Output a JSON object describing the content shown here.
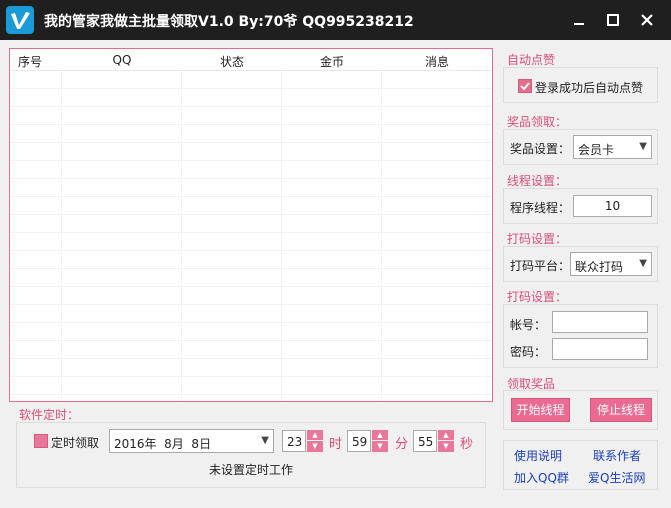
{
  "window": {
    "title": "我的管家我做主批量领取V1.0 By:70爷 QQ995238212"
  },
  "list": {
    "columns": [
      "序号",
      "QQ",
      "状态",
      "金币",
      "消息"
    ]
  },
  "auto_like": {
    "group_label": "自动点赞",
    "checkbox_label": "登录成功后自动点赞",
    "checked": true
  },
  "prize": {
    "group_label": "奖品领取：",
    "setting_label": "奖品设置：",
    "setting_value": "会员卡"
  },
  "thread": {
    "group_label": "线程设置：",
    "label": "程序线程：",
    "value": "10"
  },
  "captcha_platform": {
    "group_label": "打码设置：",
    "label": "打码平台：",
    "value": "联众打码"
  },
  "captcha_account": {
    "group_label": "打码设置：",
    "account_label": "帐号：",
    "password_label": "密码：",
    "account_value": "",
    "password_value": ""
  },
  "claim": {
    "group_label": "领取奖品",
    "start_button": "开始线程",
    "stop_button": "停止线程"
  },
  "timer": {
    "group_label": "软件定时：",
    "checkbox_label": "定时领取",
    "date_value": "2016年  8月  8日",
    "hour_value": "23",
    "hour_unit": "时",
    "minute_value": "59",
    "minute_unit": "分",
    "second_value": "55",
    "second_unit": "秒",
    "status_text": "未设置定时工作"
  },
  "links": {
    "usage": "使用说明",
    "contact": "联系作者",
    "join_group": "加入QQ群",
    "website": "爱Q生活网"
  },
  "colors": {
    "accent": "#e06f8c",
    "label_pink": "#d94f74",
    "link_blue": "#1a3fb8",
    "titlebar": "#1f1f1f"
  }
}
